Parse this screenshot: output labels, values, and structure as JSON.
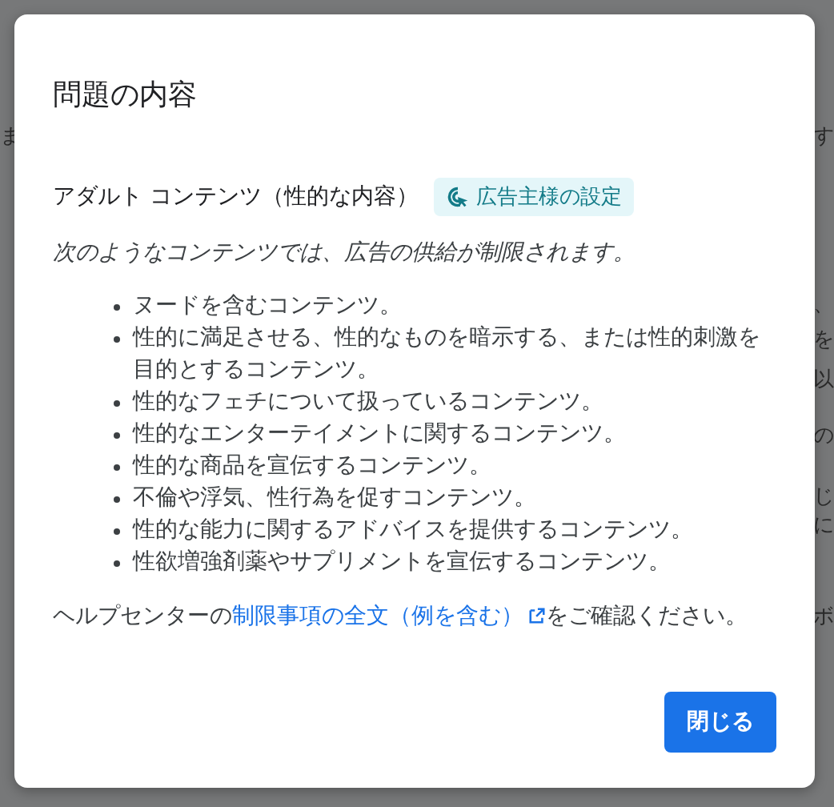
{
  "background_page": {
    "left_texts": [
      "ま"
    ],
    "right_texts": [
      "す",
      "、",
      "を",
      "以",
      "の",
      "じ",
      "に",
      "ボ"
    ]
  },
  "dialog": {
    "title": "問題の内容",
    "policy": {
      "name": "アダルト コンテンツ（性的な内容）",
      "chip": "広告主様の設定"
    },
    "intro": "次のようなコンテンツでは、広告の供給が制限されます。",
    "items": [
      "ヌードを含むコンテンツ。",
      "性的に満足させる、性的なものを暗示する、または性的刺激を目的とするコンテンツ。",
      "性的なフェチについて扱っているコンテンツ。",
      "性的なエンターテイメントに関するコンテンツ。",
      "性的な商品を宣伝するコンテンツ。",
      "不倫や浮気、性行為を促すコンテンツ。",
      "性的な能力に関するアドバイスを提供するコンテンツ。",
      "性欲増強剤薬やサプリメントを宣伝するコンテンツ。"
    ],
    "help": {
      "before": "ヘルプセンターの",
      "link": "制限事項の全文（例を含む）",
      "after": "をご確認ください。"
    },
    "buttons": [
      "閉じる"
    ]
  }
}
